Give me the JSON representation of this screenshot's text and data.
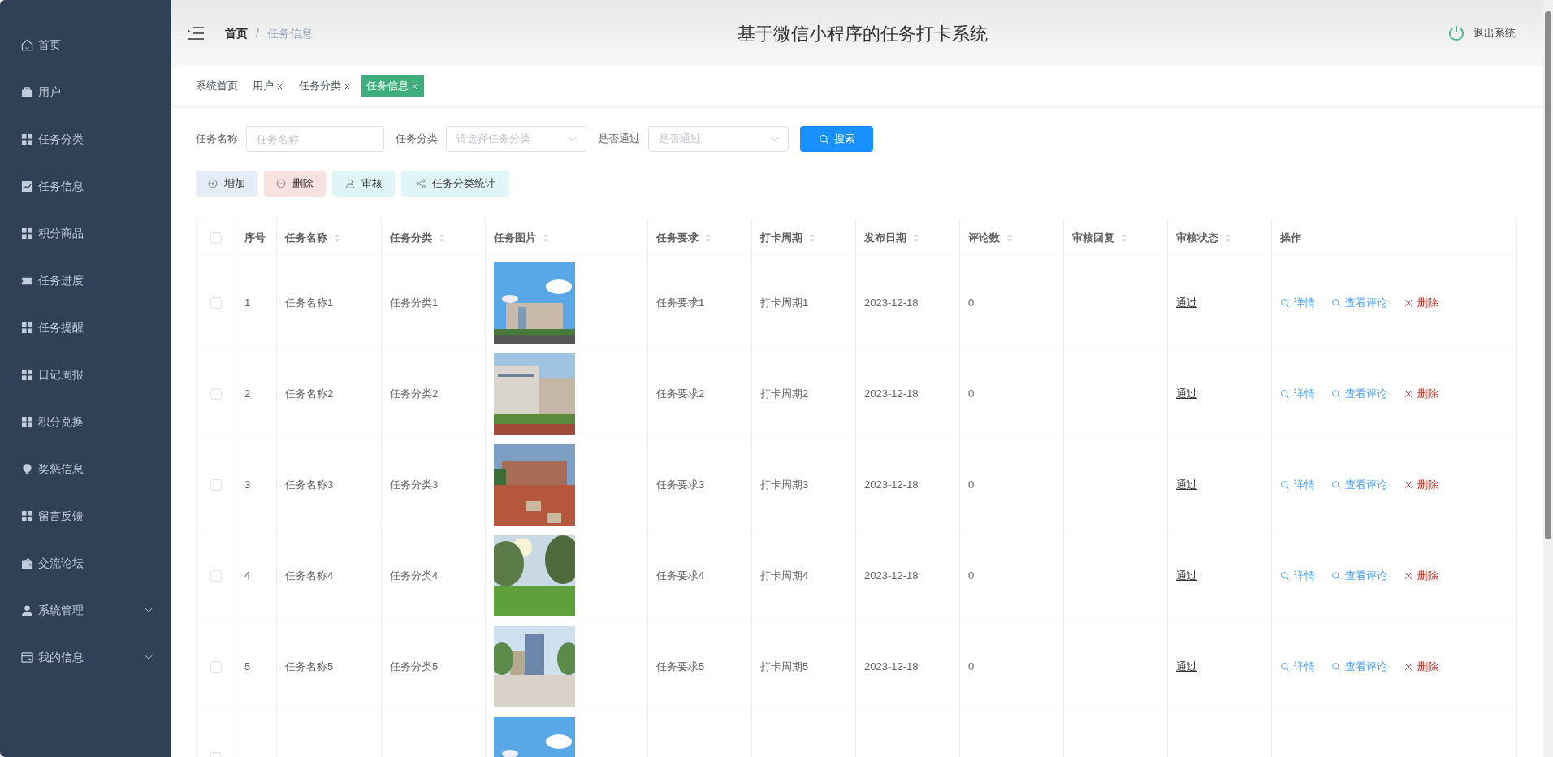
{
  "sidebar": {
    "items": [
      {
        "label": "首页",
        "has_submenu": false
      },
      {
        "label": "用户",
        "has_submenu": false
      },
      {
        "label": "任务分类",
        "has_submenu": false
      },
      {
        "label": "任务信息",
        "has_submenu": false
      },
      {
        "label": "积分商品",
        "has_submenu": false
      },
      {
        "label": "任务进度",
        "has_submenu": false
      },
      {
        "label": "任务提醒",
        "has_submenu": false
      },
      {
        "label": "日记周报",
        "has_submenu": false
      },
      {
        "label": "积分兑换",
        "has_submenu": false
      },
      {
        "label": "奖惩信息",
        "has_submenu": false
      },
      {
        "label": "留言反馈",
        "has_submenu": false
      },
      {
        "label": "交流论坛",
        "has_submenu": false
      },
      {
        "label": "系统管理",
        "has_submenu": true
      },
      {
        "label": "我的信息",
        "has_submenu": true
      }
    ]
  },
  "header": {
    "breadcrumb": [
      "首页",
      "任务信息"
    ],
    "breadcrumb_separator": "/",
    "title": "基于微信小程序的任务打卡系统",
    "logout": "退出系统"
  },
  "tabs": [
    {
      "label": "系统首页",
      "selected": false,
      "closable": false
    },
    {
      "label": "用户",
      "selected": false,
      "closable": true
    },
    {
      "label": "任务分类",
      "selected": false,
      "closable": true
    },
    {
      "label": "任务信息",
      "selected": true,
      "closable": true
    }
  ],
  "filters": [
    {
      "label": "任务名称",
      "kind": "text",
      "placeholder": "任务名称"
    },
    {
      "label": "任务分类",
      "kind": "select",
      "placeholder": "请选择任务分类"
    },
    {
      "label": "是否通过",
      "kind": "select",
      "placeholder": "是否通过"
    }
  ],
  "search_button": "搜索",
  "actions": [
    {
      "label": "增加",
      "kind": "add"
    },
    {
      "label": "删除",
      "kind": "delete"
    },
    {
      "label": "审核",
      "kind": "review"
    },
    {
      "label": "任务分类统计",
      "kind": "stats"
    }
  ],
  "table": {
    "all_checked": false,
    "columns": [
      {
        "label": "序号",
        "sortable": false
      },
      {
        "label": "任务名称",
        "sortable": true
      },
      {
        "label": "任务分类",
        "sortable": true
      },
      {
        "label": "任务图片",
        "sortable": true
      },
      {
        "label": "任务要求",
        "sortable": true
      },
      {
        "label": "打卡周期",
        "sortable": true
      },
      {
        "label": "发布日期",
        "sortable": true
      },
      {
        "label": "评论数",
        "sortable": true
      },
      {
        "label": "审核回复",
        "sortable": true
      },
      {
        "label": "审核状态",
        "sortable": true
      },
      {
        "label": "操作",
        "sortable": false
      }
    ],
    "rows": [
      {
        "checked": false,
        "index": "1",
        "name": "任务名称1",
        "category": "任务分类1",
        "image": {
          "kind": "picture"
        },
        "requirement": "任务要求1",
        "period": "打卡周期1",
        "date": "2023-12-18",
        "comments": "0",
        "status": "通过",
        "ops": [
          "详情",
          "查看评论",
          "删除"
        ]
      },
      {
        "checked": false,
        "index": "2",
        "name": "任务名称2",
        "category": "任务分类2",
        "image": {
          "kind": "picture"
        },
        "requirement": "任务要求2",
        "period": "打卡周期2",
        "date": "2023-12-18",
        "comments": "0",
        "status": "通过",
        "ops": [
          "详情",
          "查看评论",
          "删除"
        ]
      },
      {
        "checked": false,
        "index": "3",
        "name": "任务名称3",
        "category": "任务分类3",
        "image": {
          "kind": "picture"
        },
        "requirement": "任务要求3",
        "period": "打卡周期3",
        "date": "2023-12-18",
        "comments": "0",
        "status": "通过",
        "ops": [
          "详情",
          "查看评论",
          "删除"
        ]
      },
      {
        "checked": false,
        "index": "4",
        "name": "任务名称4",
        "category": "任务分类4",
        "image": {
          "kind": "picture"
        },
        "requirement": "任务要求4",
        "period": "打卡周期4",
        "date": "2023-12-18",
        "comments": "0",
        "status": "通过",
        "ops": [
          "详情",
          "查看评论",
          "删除"
        ]
      },
      {
        "checked": false,
        "index": "5",
        "name": "任务名称5",
        "category": "任务分类5",
        "image": {
          "kind": "picture"
        },
        "requirement": "任务要求5",
        "period": "打卡周期5",
        "date": "2023-12-18",
        "comments": "0",
        "status": "通过",
        "ops": [
          "详情",
          "查看评论",
          "删除"
        ]
      },
      {
        "checked": false,
        "image": {
          "kind": "picture"
        }
      }
    ]
  }
}
